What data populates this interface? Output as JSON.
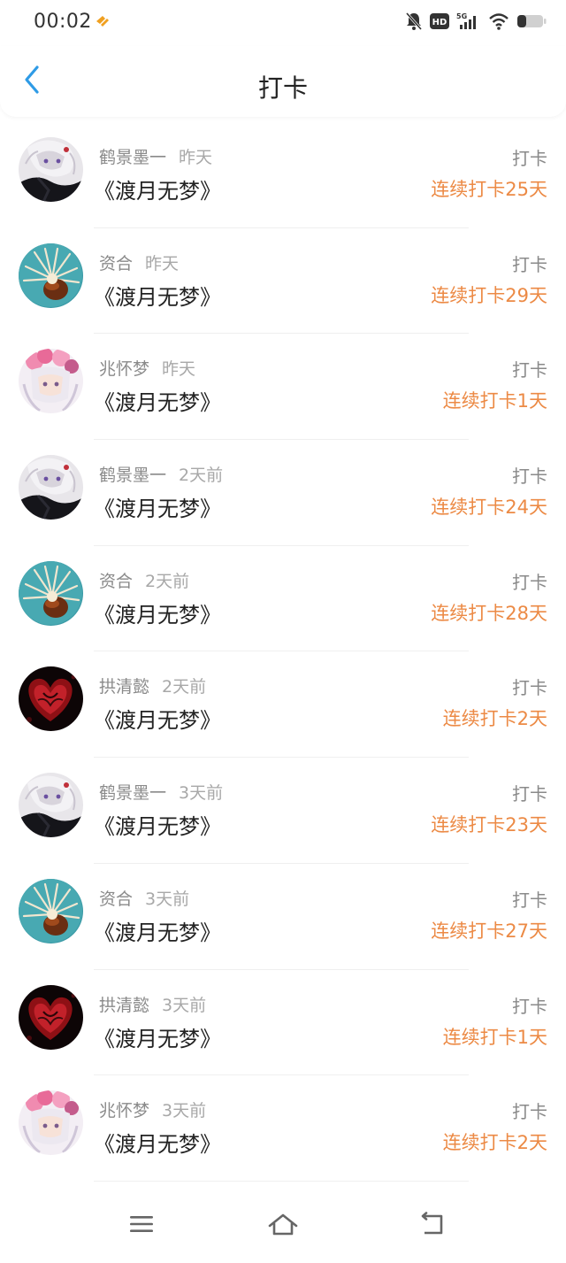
{
  "status_bar": {
    "time": "00:02",
    "icons": [
      "app-notification-icon",
      "bell-off-icon",
      "hd-icon",
      "5g-signal-icon",
      "wifi-icon",
      "battery-icon"
    ]
  },
  "header": {
    "title": "打卡",
    "back_icon": "chevron-left-icon"
  },
  "colors": {
    "accent_blue": "#2e9be6",
    "streak_orange": "#ec8a45",
    "text_dark": "#222222",
    "text_grey": "#8a8a8a"
  },
  "items": [
    {
      "name": "鹤景墨一",
      "time": "昨天",
      "title": "《渡月无梦》",
      "action": "打卡",
      "streak": "连续打卡25天",
      "avatar": "white-hair-anime"
    },
    {
      "name": "资合",
      "time": "昨天",
      "title": "《渡月无梦》",
      "action": "打卡",
      "streak": "连续打卡29天",
      "avatar": "teal-flower"
    },
    {
      "name": "兆怀梦",
      "time": "昨天",
      "title": "《渡月无梦》",
      "action": "打卡",
      "streak": "连续打卡1天",
      "avatar": "pink-flower-anime"
    },
    {
      "name": "鹤景墨一",
      "time": "2天前",
      "title": "《渡月无梦》",
      "action": "打卡",
      "streak": "连续打卡24天",
      "avatar": "white-hair-anime"
    },
    {
      "name": "资合",
      "time": "2天前",
      "title": "《渡月无梦》",
      "action": "打卡",
      "streak": "连续打卡28天",
      "avatar": "teal-flower"
    },
    {
      "name": "拱清懿",
      "time": "2天前",
      "title": "《渡月无梦》",
      "action": "打卡",
      "streak": "连续打卡2天",
      "avatar": "red-heart"
    },
    {
      "name": "鹤景墨一",
      "time": "3天前",
      "title": "《渡月无梦》",
      "action": "打卡",
      "streak": "连续打卡23天",
      "avatar": "white-hair-anime"
    },
    {
      "name": "资合",
      "time": "3天前",
      "title": "《渡月无梦》",
      "action": "打卡",
      "streak": "连续打卡27天",
      "avatar": "teal-flower"
    },
    {
      "name": "拱清懿",
      "time": "3天前",
      "title": "《渡月无梦》",
      "action": "打卡",
      "streak": "连续打卡1天",
      "avatar": "red-heart"
    },
    {
      "name": "兆怀梦",
      "time": "3天前",
      "title": "《渡月无梦》",
      "action": "打卡",
      "streak": "连续打卡2天",
      "avatar": "pink-flower-anime"
    }
  ],
  "nav_bar": {
    "icons": [
      "menu-icon",
      "home-icon",
      "back-icon"
    ]
  }
}
